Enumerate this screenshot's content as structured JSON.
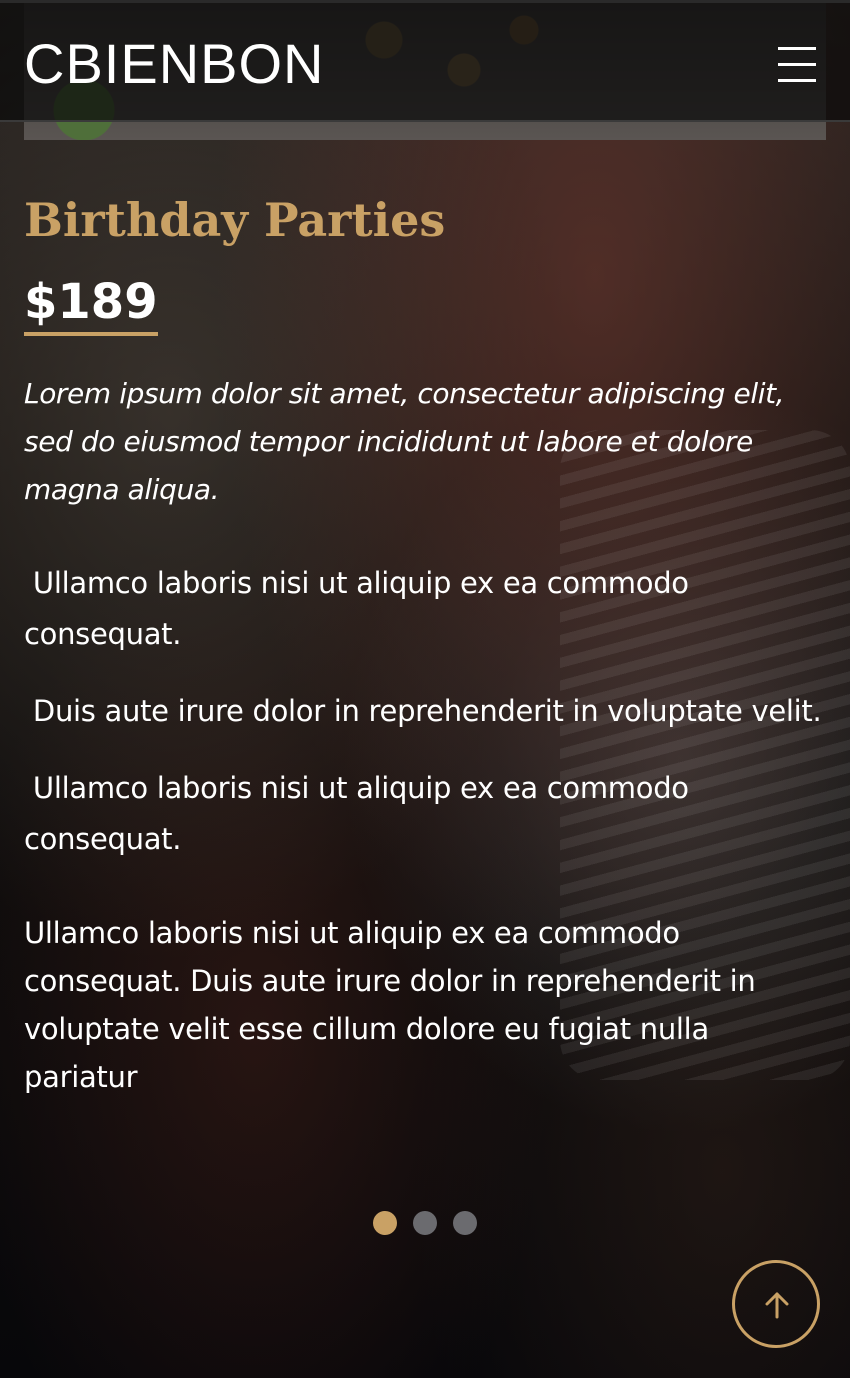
{
  "header": {
    "logo": "CBIENBON",
    "menu_icon": "hamburger-menu-icon"
  },
  "slide": {
    "title": "Birthday Parties",
    "price": "$189",
    "intro": "Lorem ipsum dolor sit amet, consectetur adipiscing elit, sed do eiusmod tempor incididunt ut labore et dolore magna aliqua.",
    "features": [
      " Ullamco laboris nisi ut aliquip ex ea commodo consequat.",
      " Duis aute irure dolor in reprehenderit in voluptate velit.",
      " Ullamco laboris nisi ut aliquip ex ea commodo consequat."
    ],
    "body": "Ullamco laboris nisi ut aliquip ex ea commodo consequat. Duis aute irure dolor in reprehenderit in voluptate velit esse cillum dolore eu fugiat nulla pariatur"
  },
  "carousel": {
    "total_slides": 3,
    "active_index": 0
  },
  "scroll_top": {
    "icon": "arrow-up-icon"
  },
  "colors": {
    "accent": "#c9a165",
    "inactive_dot": "#6b6b6f",
    "text": "#ffffff"
  }
}
